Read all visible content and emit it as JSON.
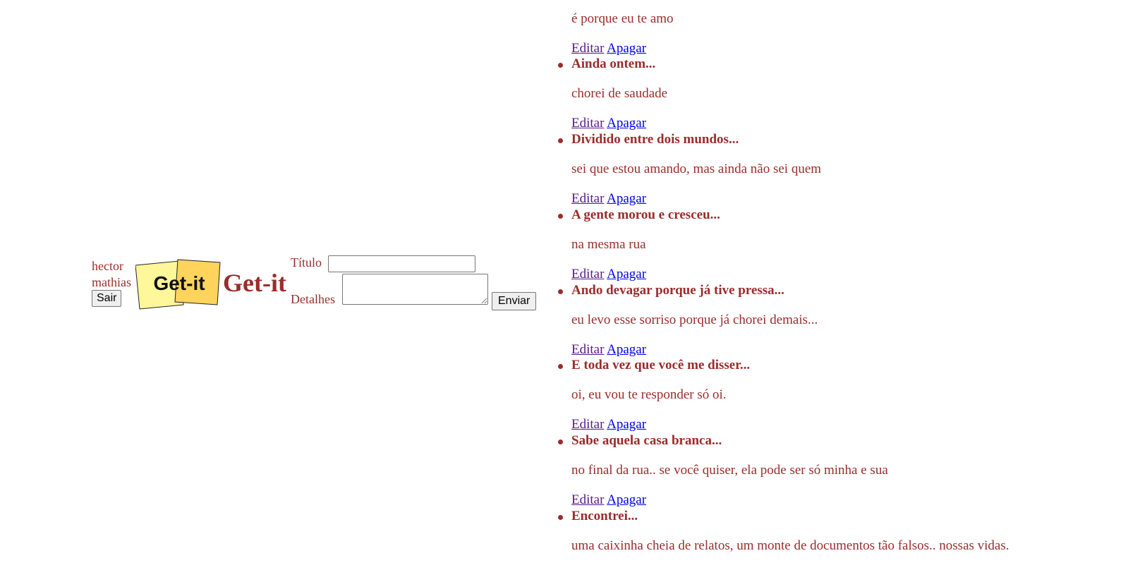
{
  "user": {
    "first_name": "hector",
    "last_name": "mathias",
    "logout_label": "Sair"
  },
  "brand": {
    "logo_text": "Get-it",
    "title": "Get-it"
  },
  "form": {
    "title_label": "Título",
    "title_value": "",
    "details_label": "Detalhes",
    "details_value": "",
    "submit_label": "Enviar"
  },
  "actions": {
    "edit_label": "Editar",
    "delete_label": "Apagar"
  },
  "intro_note": {
    "body": "é porque eu te amo"
  },
  "notes": [
    {
      "title": "Ainda ontem...",
      "body": "chorei de saudade"
    },
    {
      "title": "Dividido entre dois mundos...",
      "body": "sei que estou amando, mas ainda não sei quem"
    },
    {
      "title": "A gente morou e cresceu...",
      "body": "na mesma rua"
    },
    {
      "title": "Ando devagar porque já tive pressa...",
      "body": "eu levo esse sorriso porque já chorei demais..."
    },
    {
      "title": "E toda vez que você me disser...",
      "body": "oi, eu vou te responder só oi."
    },
    {
      "title": "Sabe aquela casa branca...",
      "body": "no final da rua.. se você quiser, ela pode ser só minha e sua"
    },
    {
      "title": "Encontrei...",
      "body": "uma caixinha cheia de relatos, um monte de documentos tão falsos.. nossas vidas."
    }
  ],
  "colors": {
    "text": "#9b2c2c",
    "visited_link": "#551a8b",
    "link": "#0000ee",
    "logo_yellow_light": "#fff799",
    "logo_yellow_dark": "#ffd45c"
  }
}
